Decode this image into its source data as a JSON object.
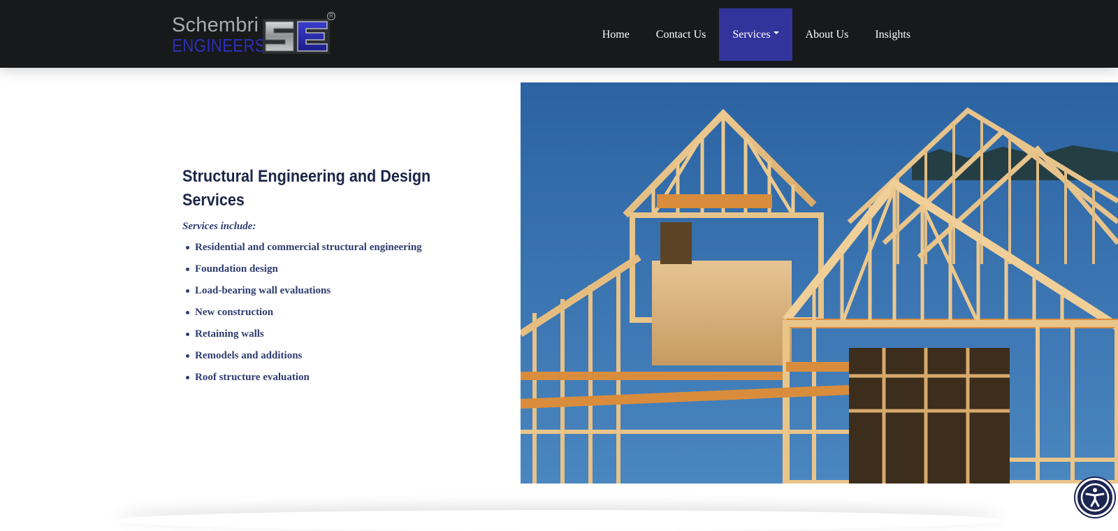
{
  "brand": {
    "word1": "Schembri",
    "word2": "ENGINEERS",
    "monogram": "SE",
    "registered_mark": "R",
    "colors": {
      "silver": "#a9abad",
      "blue": "#2c2fb6"
    }
  },
  "nav": {
    "items": [
      {
        "label": "Home"
      },
      {
        "label": "Contact Us"
      },
      {
        "label": "Services",
        "active": true,
        "has_dropdown": true
      },
      {
        "label": "About Us"
      },
      {
        "label": "Insights"
      }
    ],
    "colors": {
      "background": "#18191b",
      "active": "#32349b",
      "text": "#ffffff"
    }
  },
  "content": {
    "heading": "Structural Engineering and Design Services",
    "intro": "Services include:",
    "services": [
      "Residential and commercial structural engineering",
      "Foundation design",
      "Load-bearing wall evaluations",
      "New construction",
      "Retaining walls",
      "Remodels and additions",
      "Roof structure evaluation"
    ],
    "colors": {
      "heading": "#1c2548",
      "body": "#2f3c6e"
    }
  },
  "hero_image": {
    "subject": "wood-framed house under construction against blue sky"
  },
  "accessibility": {
    "icon": "accessibility-icon",
    "color": "#1d2553"
  }
}
